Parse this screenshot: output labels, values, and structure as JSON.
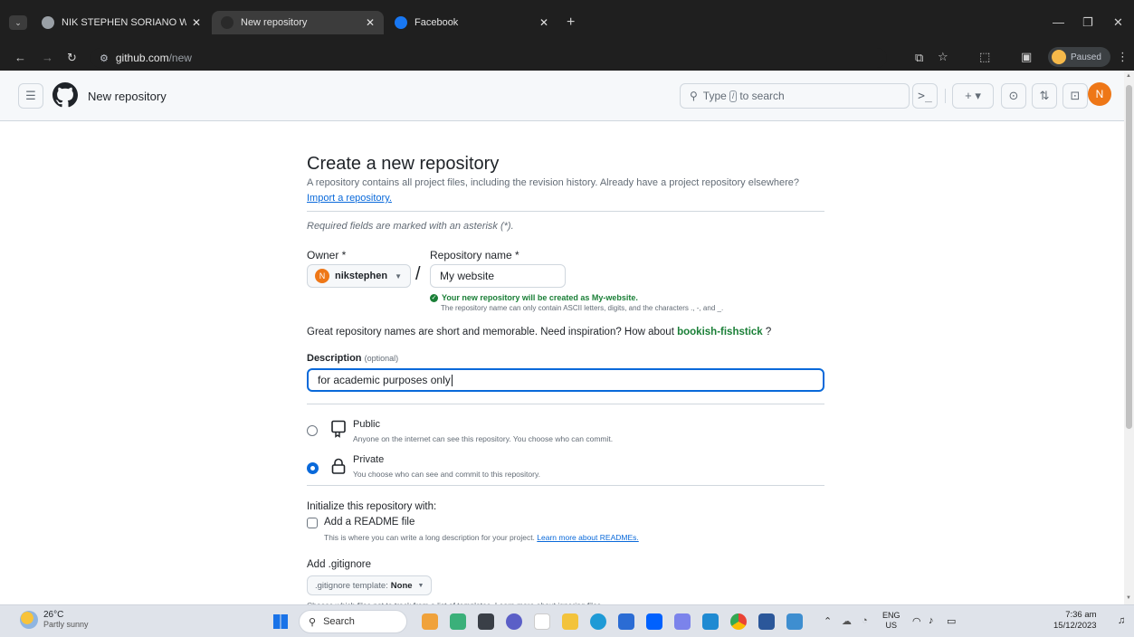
{
  "browser": {
    "tabs": [
      {
        "title": "NIK STEPHEN SORIANO WEBSI",
        "favicon_color": "#9aa0a6"
      },
      {
        "title": "New repository",
        "favicon_color": "#3c3c3c"
      },
      {
        "title": "Facebook",
        "favicon_color": "#1877f2"
      }
    ],
    "url_host": "github.com",
    "url_path": "/new",
    "profile_status": "Paused"
  },
  "header": {
    "title": "New repository",
    "search_prefix": "Type",
    "search_key": "/",
    "search_suffix": "to search",
    "avatar_letter": "N",
    "avatar_color": "#ee7717"
  },
  "form": {
    "title": "Create a new repository",
    "intro": "A repository contains all project files, including the revision history. Already have a project repository elsewhere?",
    "import_link": "Import a repository.",
    "required_note": "Required fields are marked with an asterisk (*).",
    "owner_label": "Owner *",
    "owner_value": "nikstephen",
    "owner_avatar": "N",
    "repo_label": "Repository name *",
    "repo_value": "My website",
    "success_msg": "Your new repository will be created as My-website.",
    "name_rules": "The repository name can only contain ASCII letters, digits, and the characters ., -, and _.",
    "suggestion_text": "Great repository names are short and memorable. Need inspiration? How about",
    "suggestion_name": "bookish-fishstick",
    "suggestion_end": "?",
    "description_label": "Description",
    "description_optional": "(optional)",
    "description_value": "for academic purposes only",
    "public_label": "Public",
    "public_desc": "Anyone on the internet can see this repository. You choose who can commit.",
    "private_label": "Private",
    "private_desc": "You choose who can see and commit to this repository.",
    "init_label": "Initialize this repository with:",
    "readme_label": "Add a README file",
    "readme_desc": "This is where you can write a long description for your project.",
    "readme_link": "Learn more about READMEs.",
    "gitignore_label": "Add .gitignore",
    "gitignore_btn_prefix": ".gitignore template:",
    "gitignore_btn_value": "None",
    "gitignore_desc": "Choose which files not to track from a list of templates. Learn more about ignoring files."
  },
  "taskbar": {
    "weather_temp": "26°C",
    "weather_desc": "Partly sunny",
    "search_label": "Search",
    "lang": "ENG",
    "region": "US",
    "time": "7:36 am",
    "date": "15/12/2023"
  },
  "colors": {
    "accent_green": "#1a7f37",
    "link_blue": "#0969da",
    "focus_blue": "#0969da"
  }
}
